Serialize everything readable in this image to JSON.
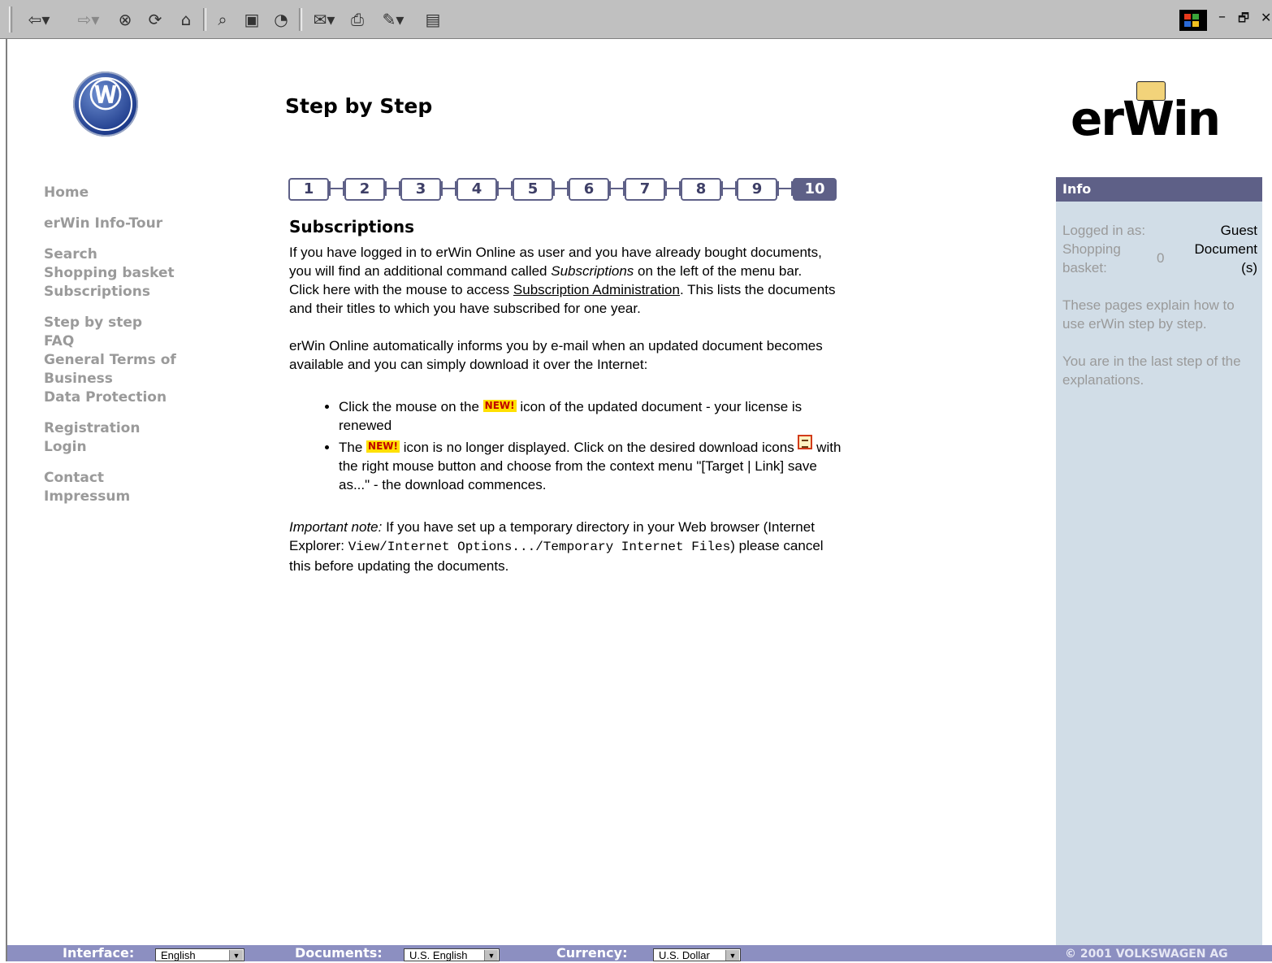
{
  "browser": {
    "toolbar_icons": [
      "back-arrow-icon",
      "forward-arrow-icon",
      "stop-icon",
      "refresh-icon",
      "home-icon",
      "search-icon",
      "favorites-icon",
      "history-icon",
      "mail-icon",
      "print-icon",
      "edit-icon",
      "discuss-icon"
    ],
    "window_controls": [
      "minimize",
      "restore",
      "close"
    ]
  },
  "header": {
    "page_title": "Step by Step",
    "brand_logo_text": "erWin"
  },
  "nav": {
    "groups": [
      [
        "Home"
      ],
      [
        "erWin Info-Tour"
      ],
      [
        "Search",
        "Shopping basket",
        "Subscriptions"
      ],
      [
        "Step by step",
        "FAQ",
        "General Terms of",
        "Business",
        "Data Protection"
      ],
      [
        "Registration",
        "Login"
      ],
      [
        "Contact",
        "Impressum"
      ]
    ]
  },
  "steps": {
    "labels": [
      "1",
      "2",
      "3",
      "4",
      "5",
      "6",
      "7",
      "8",
      "9",
      "10"
    ],
    "active": "10"
  },
  "content": {
    "heading": "Subscriptions",
    "p1a": "If you have logged in to erWin Online as user and you have already bought documents, you will find an additional command called ",
    "p1_em": "Subscriptions",
    "p1b": " on the left of the menu bar.",
    "p2a": "Click here with the mouse to access ",
    "p2_link": "Subscription Administration",
    "p2b": ". This lists the documents and their titles to which you have subscribed for one year.",
    "p3": "erWin Online automatically informs you by e-mail when an updated document becomes available and you can simply download it over the Internet:",
    "li1a": "Click the mouse on the ",
    "li1b": " icon of the updated document - your license is renewed",
    "li2a": "The ",
    "li2b": " icon is no longer displayed. Click on the desired download icons ",
    "li2c": " with the right mouse button and choose from the context menu \"[Target | Link] save as...\" - the download commences.",
    "new_badge": "NEW!",
    "note_em": "Important note:",
    "note_a": " If you have set up a temporary directory in your Web browser (Internet Explorer: ",
    "note_code": "View/Internet Options.../Temporary Internet Files",
    "note_b": ") please cancel this before updating the documents."
  },
  "info": {
    "title": "Info",
    "logged_in_label": "Logged in as:",
    "logged_in_value": "Guest",
    "basket_label": "Shopping basket:",
    "basket_count": "0",
    "basket_unit": "Document (s)",
    "text1": "These pages explain how to use erWin step by step.",
    "text2": "You are in the last step of the explanations."
  },
  "footer": {
    "interface_label": "Interface:",
    "interface_value": "English",
    "documents_label": "Documents:",
    "documents_value": "U.S. English",
    "currency_label": "Currency:",
    "currency_value": "U.S. Dollar",
    "copyright": "© 2001 VOLKSWAGEN AG"
  },
  "colors": {
    "accent": "#5e6087",
    "info_bg": "#d1dde7",
    "footer_bg": "#8c8fc1",
    "nav_text": "#9a9a9a"
  }
}
